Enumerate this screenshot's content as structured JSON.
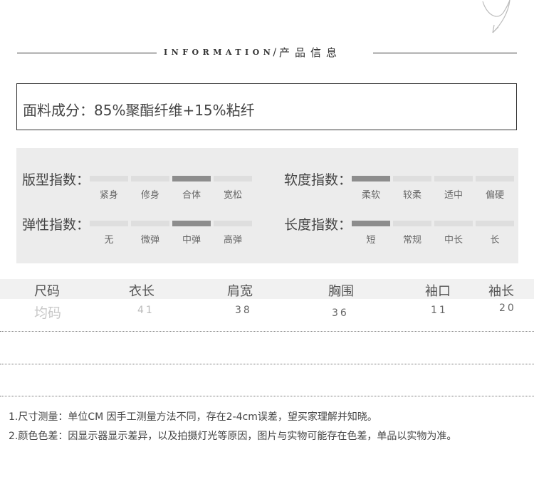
{
  "header": {
    "title_en": "INFORMATION",
    "separator": "/",
    "title_cn": "产品信息"
  },
  "fabric": {
    "text": "面料成分：85%聚酯纤维+15%粘纤"
  },
  "metrics": [
    {
      "label": "版型指数：",
      "options": [
        "紧身",
        "修身",
        "合体",
        "宽松"
      ],
      "selected": 2
    },
    {
      "label": "软度指数：",
      "options": [
        "柔软",
        "较柔",
        "适中",
        "偏硬"
      ],
      "selected": 0
    },
    {
      "label": "弹性指数：",
      "options": [
        "无",
        "微弹",
        "中弹",
        "高弹"
      ],
      "selected": 2
    },
    {
      "label": "长度指数：",
      "options": [
        "短",
        "常规",
        "中长",
        "长"
      ],
      "selected": 0
    }
  ],
  "size_table": {
    "headers": [
      "尺码",
      "衣长",
      "肩宽",
      "胸围",
      "袖口",
      "袖长"
    ],
    "rows": [
      [
        "均码",
        "41",
        "38",
        "36",
        "11",
        "20"
      ]
    ]
  },
  "notes": [
    "1.尺寸测量：单位CM 因手工测量方法不同，存在2-4cm误差，望买家理解并知晓。",
    "2.颜色色差：因显示器显示差异，以及拍摄灯光等原因，图片与实物可能存在色差，单品以实物为准。"
  ],
  "colors": {
    "bar_active": "#8d8d8d",
    "bar_inactive": "#dedede",
    "panel_bg": "#ececec"
  }
}
